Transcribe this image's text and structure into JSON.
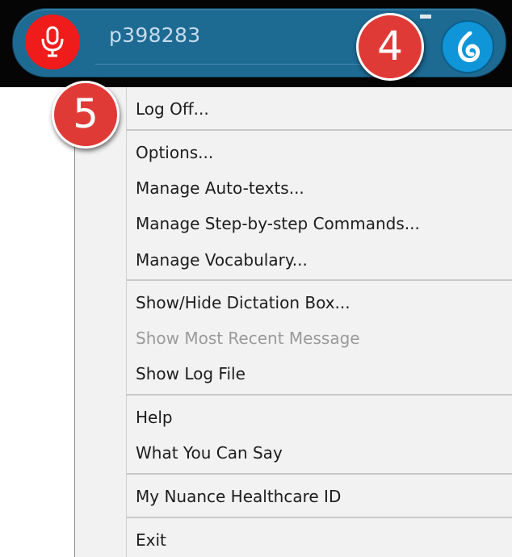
{
  "toolbar": {
    "username": "p398283",
    "colors": {
      "bar": "#1d6a93",
      "mic": "#f01b1b",
      "dragon": "#0f95d8"
    },
    "icons": {
      "mic": "microphone-icon",
      "logo": "dragon-logo-icon",
      "minimize": "minimize-icon"
    }
  },
  "callouts": {
    "four": "4",
    "five": "5"
  },
  "menu": {
    "items": [
      {
        "label": "Log Off...",
        "enabled": true
      },
      {
        "label": "Options...",
        "enabled": true
      },
      {
        "label": "Manage Auto-texts...",
        "enabled": true
      },
      {
        "label": "Manage Step-by-step Commands...",
        "enabled": true
      },
      {
        "label": "Manage Vocabulary...",
        "enabled": true
      },
      {
        "label": "Show/Hide Dictation Box...",
        "enabled": true
      },
      {
        "label": "Show Most Recent Message",
        "enabled": false
      },
      {
        "label": "Show Log File",
        "enabled": true
      },
      {
        "label": "Help",
        "enabled": true
      },
      {
        "label": "What You Can Say",
        "enabled": true
      },
      {
        "label": "My Nuance Healthcare ID",
        "enabled": true
      },
      {
        "label": "Exit",
        "enabled": true
      }
    ]
  }
}
